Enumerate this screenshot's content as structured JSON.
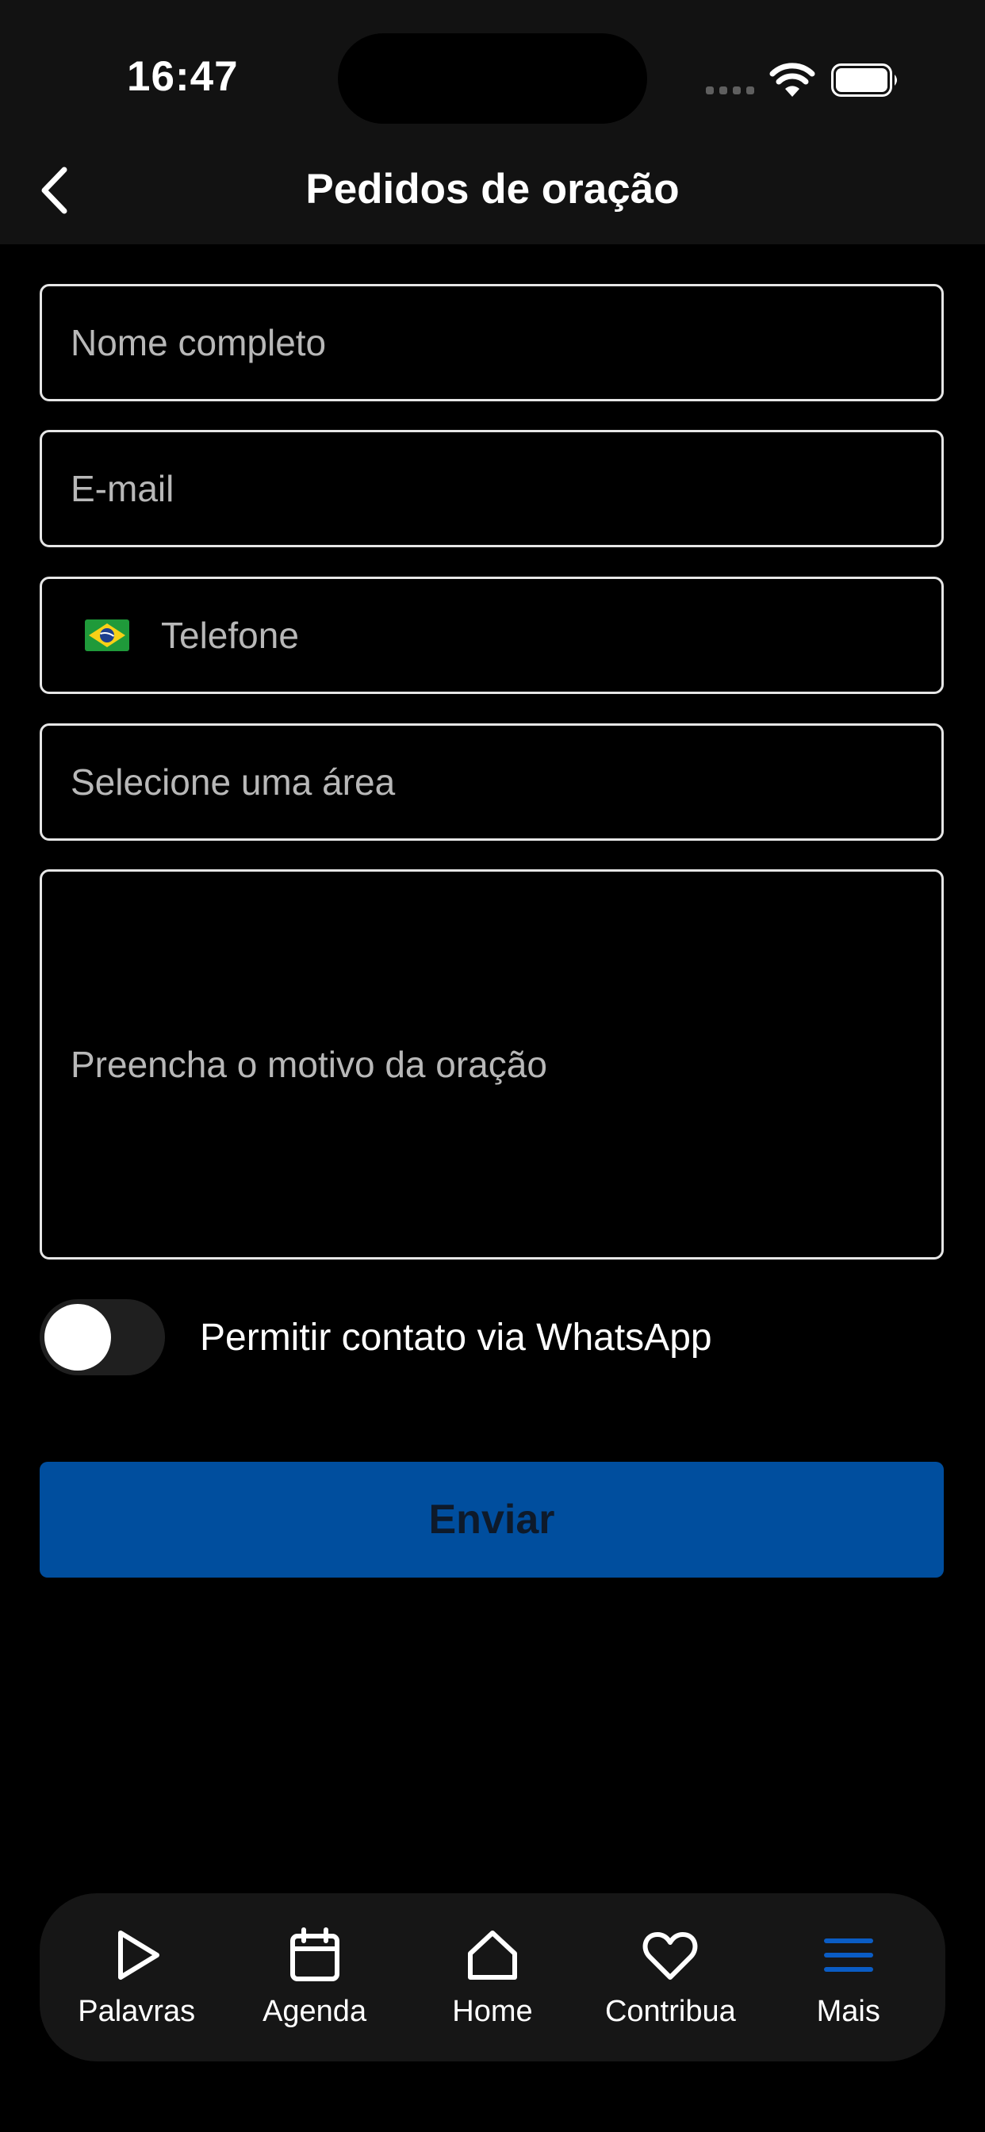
{
  "status_bar": {
    "time": "16:47",
    "icons": [
      "cellular-signal-icon",
      "wifi-icon",
      "battery-icon"
    ]
  },
  "nav": {
    "title": "Pedidos de oração",
    "back_icon": "chevron-left-icon"
  },
  "form": {
    "name_placeholder": "Nome completo",
    "email_placeholder": "E-mail",
    "phone_placeholder": "Telefone",
    "phone_flag_icon": "brazil-flag-icon",
    "area_placeholder": "Selecione uma área",
    "reason_placeholder": "Preencha o motivo da oração",
    "whatsapp_toggle_label": "Permitir contato via WhatsApp",
    "whatsapp_toggle_on": false,
    "submit_label": "Enviar"
  },
  "tabs": [
    {
      "label": "Palavras",
      "icon": "play-icon",
      "active": false
    },
    {
      "label": "Agenda",
      "icon": "calendar-icon",
      "active": false
    },
    {
      "label": "Home",
      "icon": "home-icon",
      "active": false
    },
    {
      "label": "Contribua",
      "icon": "heart-icon",
      "active": false
    },
    {
      "label": "Mais",
      "icon": "menu-icon",
      "active": true
    }
  ],
  "colors": {
    "accent": "#004E9E",
    "active_tab_icon": "#0A5CC4",
    "background": "#000000",
    "header": "#121212",
    "tab_bar": "#161616"
  }
}
